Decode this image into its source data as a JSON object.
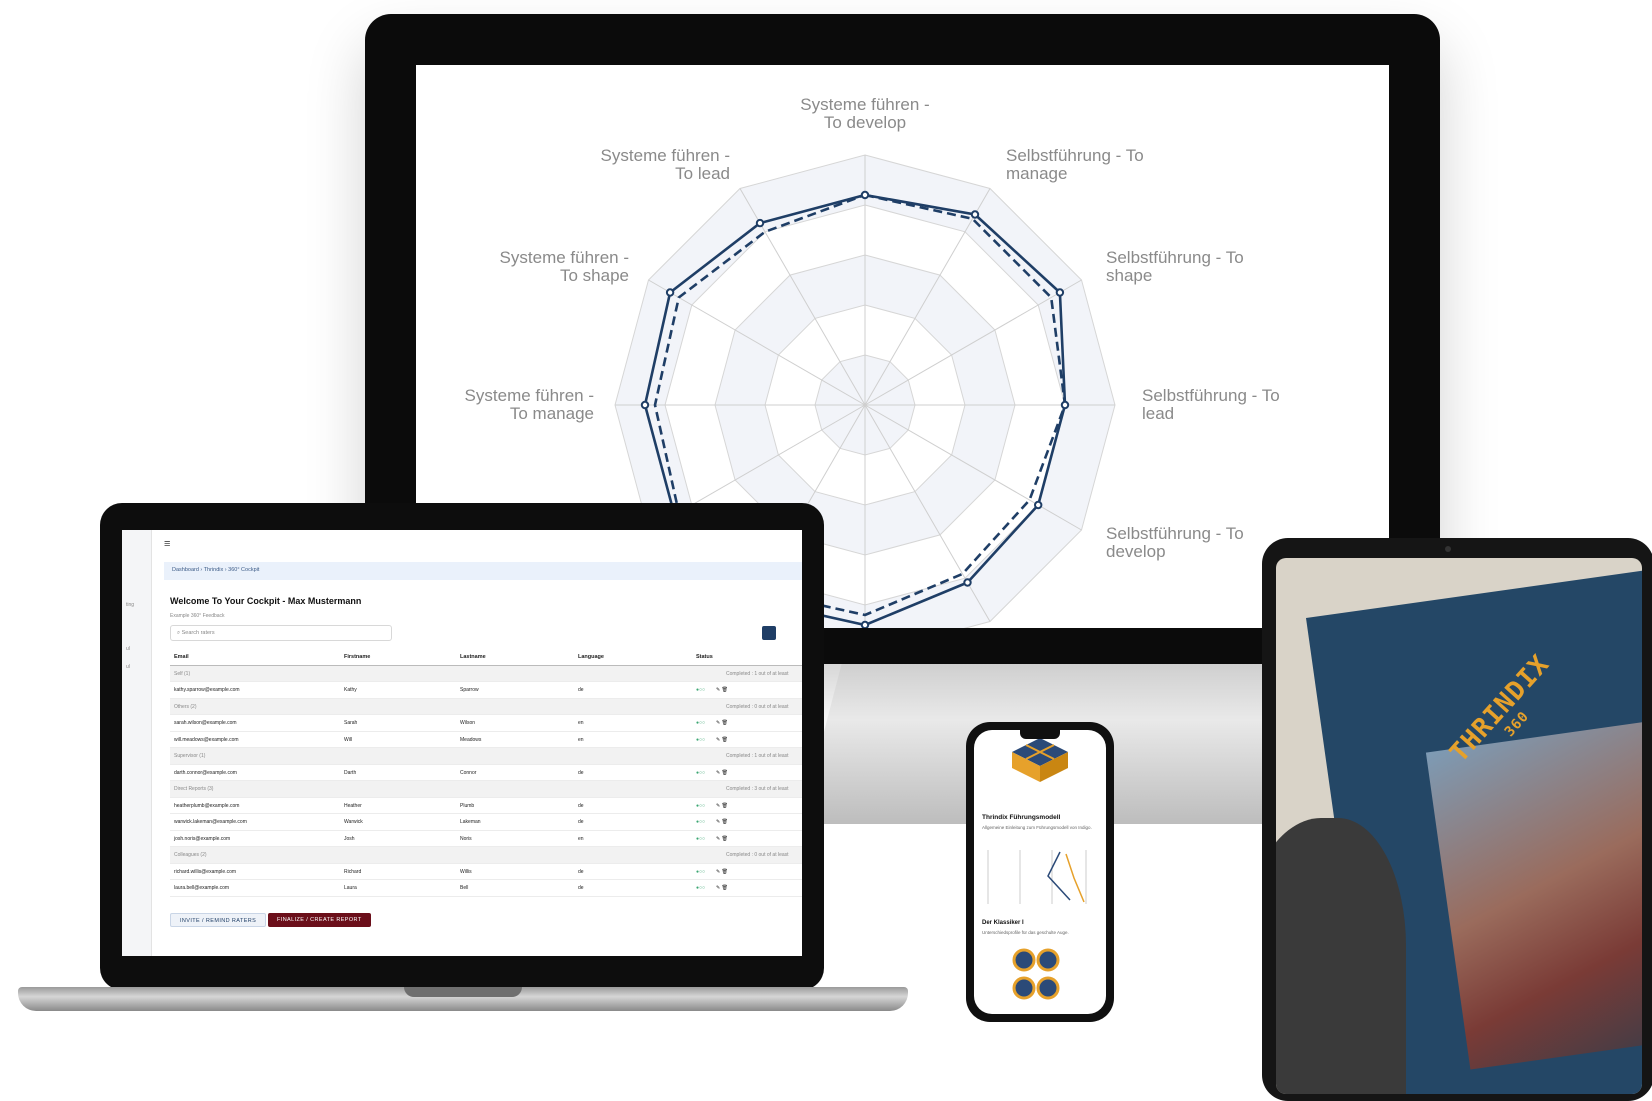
{
  "radar": {
    "axes": [
      "Systeme führen - To develop",
      "Selbstführung - To manage",
      "Selbstführung - To shape",
      "Selbstführung - To lead",
      "Selbstführung - To develop",
      "Systeme führen - To manage",
      "Systeme führen - To shape",
      "Systeme führen - To lead"
    ],
    "series_color": "#1f3e66"
  },
  "laptop": {
    "menu_icon": "hamburger-icon",
    "breadcrumb": "Dashboard  ›  Thrindix  ›  360° Cockpit",
    "title": "Welcome To Your Cockpit - Max Mustermann",
    "subtitle": "Example 360° Feedback",
    "search_placeholder": "Search raters",
    "columns": [
      "Email",
      "Firstname",
      "Lastname",
      "Language",
      "Status"
    ],
    "groups": [
      {
        "label": "Self (1)",
        "status": "Completed : 1 out of at least",
        "rows": [
          {
            "email": "kathy.sparrow@example.com",
            "first": "Kathy",
            "last": "Sparrow",
            "lang": "de"
          }
        ]
      },
      {
        "label": "Others (2)",
        "status": "Completed : 0 out of at least",
        "rows": [
          {
            "email": "sarah.wilson@example.com",
            "first": "Sarah",
            "last": "Wilson",
            "lang": "en"
          },
          {
            "email": "will.meadows@example.com",
            "first": "Will",
            "last": "Meadows",
            "lang": "en"
          }
        ]
      },
      {
        "label": "Supervisor (1)",
        "status": "Completed : 1 out of at least",
        "rows": [
          {
            "email": "darth.connor@example.com",
            "first": "Darth",
            "last": "Connor",
            "lang": "de"
          }
        ]
      },
      {
        "label": "Direct Reports (3)",
        "status": "Completed : 3 out of at least",
        "rows": [
          {
            "email": "heatherplumb@example.com",
            "first": "Heather",
            "last": "Plumb",
            "lang": "de"
          },
          {
            "email": "warwick.lakeman@example.com",
            "first": "Warwick",
            "last": "Lakeman",
            "lang": "de"
          },
          {
            "email": "josh.noris@example.com",
            "first": "Josh",
            "last": "Noris",
            "lang": "en"
          }
        ]
      },
      {
        "label": "Colleagues (2)",
        "status": "Completed : 0 out of at least",
        "rows": [
          {
            "email": "richard.willis@example.com",
            "first": "Richard",
            "last": "Willis",
            "lang": "de"
          },
          {
            "email": "laura.bell@example.com",
            "first": "Laura",
            "last": "Bell",
            "lang": "de"
          }
        ]
      }
    ],
    "invite_button": "INVITE / REMIND RATERS",
    "finalize_button": "FINALIZE / CREATE REPORT"
  },
  "phone": {
    "heading_1": "Thrindix Führungsmodell",
    "text_1": "Allgemeine Einleitung zum Führungsmodell von Indigo.",
    "heading_2": "Der Klassiker I",
    "text_2": "Unterschiedsprofile für das geschulte Auge."
  },
  "tablet": {
    "logo_text": "THRINDIX",
    "logo_sub": "360",
    "accent_color": "#e6a12b"
  }
}
